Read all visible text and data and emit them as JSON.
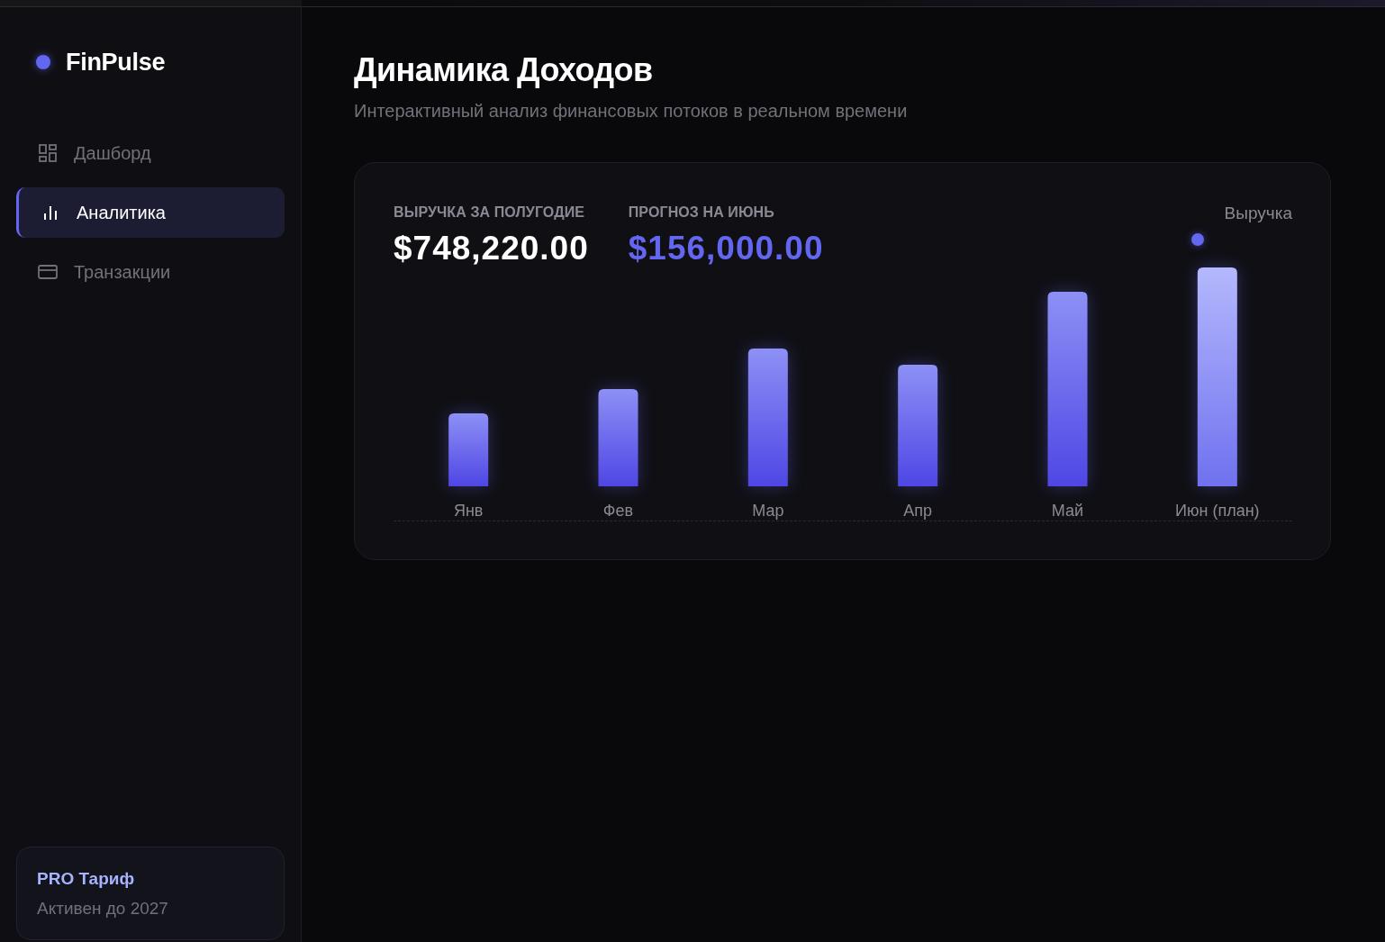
{
  "sidebar": {
    "brand": "FinPulse",
    "nav": [
      {
        "label": "Дашборд",
        "selected": false
      },
      {
        "label": "Аналитика",
        "selected": true
      },
      {
        "label": "Транзакции",
        "selected": false
      }
    ],
    "plan_card": {
      "title": "PRO Тариф",
      "subtitle": "Активен до 2027"
    }
  },
  "header": {
    "title": "Динамика Доходов",
    "subtitle": "Интерактивный анализ финансовых потоков в реальном времени"
  },
  "revenue_card": {
    "stats": [
      {
        "label": "ВЫРУЧКА ЗА ПОЛУГОДИЕ",
        "value": "$748,220.00",
        "kind": "total"
      },
      {
        "label": "ПРОГНОЗ НА ИЮНЬ",
        "value": "$156,000.00",
        "kind": "forecast"
      }
    ],
    "legend": "Выручка",
    "months": [
      {
        "label": "Янв",
        "kind": "actual"
      },
      {
        "label": "Фев",
        "kind": "actual"
      },
      {
        "label": "Мар",
        "kind": "actual"
      },
      {
        "label": "Апр",
        "kind": "actual"
      },
      {
        "label": "Май",
        "kind": "actual"
      },
      {
        "label": "Июн (план)",
        "kind": "forecast"
      }
    ]
  }
}
